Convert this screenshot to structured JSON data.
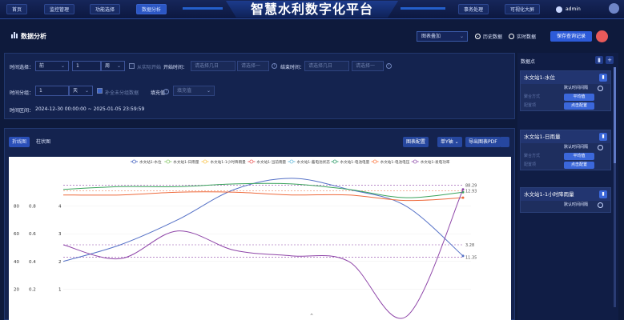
{
  "nav": {
    "left": [
      "首页",
      "监控管理",
      "功能选择",
      "数据分析"
    ],
    "right": [
      "事务处理",
      "可视化大屏"
    ],
    "title": "智慧水利数字化平台",
    "user": "admin"
  },
  "header": {
    "title": "数据分析",
    "mode_select": "图表叠加",
    "radio_history": "历史数据",
    "radio_realtime": "实时数据",
    "save_button": "保存查询记录"
  },
  "filters": {
    "time_select_label": "时间选择：",
    "time_select_value": "前",
    "time_num_value": "1",
    "time_unit_value": "周",
    "from_real_start": "从实际开始",
    "start_label": "开始时间：",
    "start_date_placeholder": "请选择几日",
    "start_time_placeholder": "请选择一",
    "end_label": "结束时间：",
    "end_date_placeholder": "请选择几日",
    "end_time_placeholder": "请选择一",
    "group_label": "时间分组：",
    "group_num": "1",
    "group_unit": "天",
    "fill_missing": "补全未分组数据",
    "fill_label": "填充值",
    "fill_placeholder": "填充值",
    "range_label": "时间区间：",
    "range_value": "2024-12-30 00:00:00 ~ 2025-01-05 23:59:59"
  },
  "chart_tools": {
    "tab_line": "折线图",
    "tab_bar": "柱状图",
    "config": "图表配置",
    "axis": "单Y轴",
    "export": "导出图表PDF"
  },
  "chart_data": {
    "type": "line",
    "legend_position": "top",
    "legend": [
      "水文站1-水位",
      "水文站1-日雨量",
      "水文站1-1小时降雨量",
      "水文站1-当前雨量",
      "水文站1-蓄电池状态",
      "水文站1-电池电量",
      "水文站1-电池电压",
      "水文站1-发电功率"
    ],
    "y_ticks_col1": [
      "80",
      "60",
      "40",
      "20"
    ],
    "y_ticks_col2": [
      "0.8",
      "0.6",
      "0.4",
      "0.2"
    ],
    "y_ticks_col3": [
      "4",
      "3",
      "2",
      "1"
    ],
    "mark_labels": [
      "88.29",
      "12.93",
      "3.28",
      "11.35"
    ],
    "series": [
      {
        "name": "水文站1-水位",
        "color": "#5470c6",
        "values": [
          2.0,
          2.6,
          3.5,
          4.6,
          5.0,
          4.6,
          4.0,
          2.2
        ]
      },
      {
        "name": "水文站1-日雨量",
        "color": "#3aa35c",
        "values": [
          4.6,
          4.7,
          4.7,
          4.8,
          4.8,
          4.6,
          4.3,
          4.5
        ]
      },
      {
        "name": "水文站1-电池电压",
        "color": "#ee6a3c",
        "values": [
          4.4,
          4.4,
          4.5,
          4.5,
          4.4,
          4.4,
          4.2,
          4.3
        ]
      },
      {
        "name": "水文站1-发电功率",
        "color": "#8e45a8",
        "values": [
          2.6,
          2.1,
          3.1,
          2.4,
          2.2,
          2.0,
          0.0,
          4.6
        ]
      }
    ]
  },
  "data_panel": {
    "title": "数据点",
    "stations": [
      {
        "name": "水文站1-水位",
        "time": "默认时间间隔",
        "agg_label": "聚合方式",
        "agg": "平均值",
        "config_label": "配置项",
        "config": "点击配置"
      },
      {
        "name": "水文站1-日雨量",
        "time": "默认时间间隔",
        "agg_label": "聚合方式",
        "agg": "平均值",
        "config_label": "配置项",
        "config": "点击配置"
      },
      {
        "name": "水文站1-1小时降雨量",
        "time": "默认时间间隔",
        "agg_label": "",
        "agg": "",
        "config_label": "",
        "config": ""
      }
    ]
  },
  "icons": [
    "bar-chart-icon",
    "chevron-down-icon",
    "info-icon",
    "calendar-icon",
    "clock-icon",
    "trash-icon",
    "plus-icon",
    "settings-icon",
    "chat-icon",
    "chevron-up-icon"
  ]
}
